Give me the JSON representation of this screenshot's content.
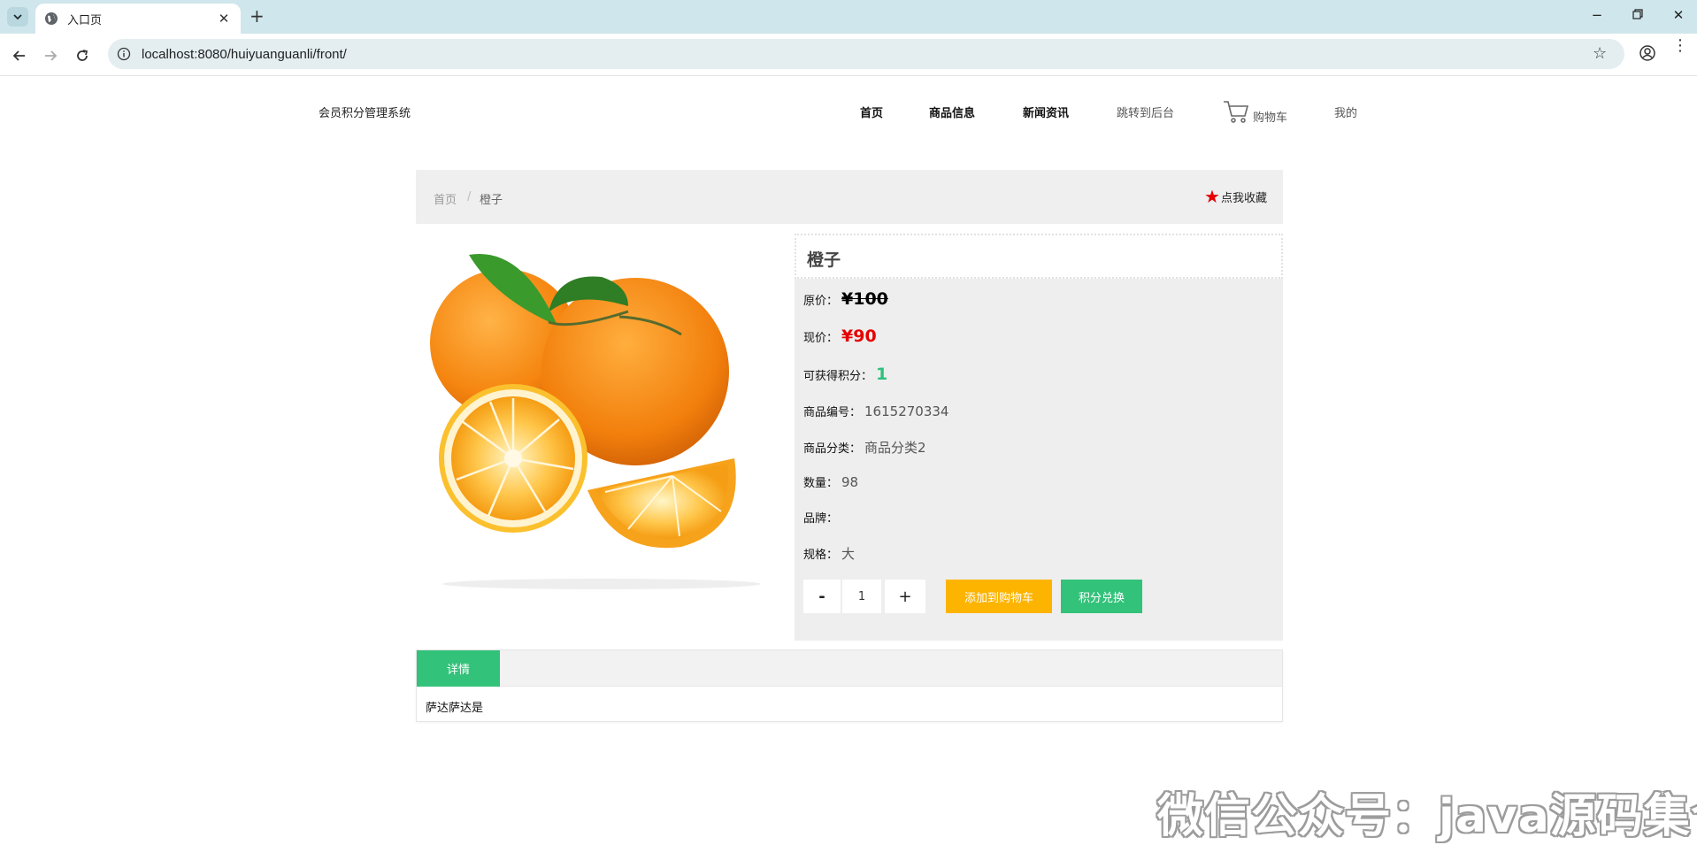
{
  "browser": {
    "tab_title": "入口页",
    "url": "localhost:8080/huiyuanguanli/front/"
  },
  "header": {
    "site_title": "会员积分管理系统",
    "nav": [
      "首页",
      "商品信息",
      "新闻资讯",
      "跳转到后台",
      "购物车",
      "我的"
    ]
  },
  "breadcrumb": {
    "home": "首页",
    "separator": "/",
    "current": "橙子",
    "favorite_label": "点我收藏"
  },
  "product": {
    "name": "橙子",
    "original_price_label": "原价：",
    "original_price": "¥100",
    "current_price_label": "现价：",
    "current_price": "¥90",
    "points_label": "可获得积分：",
    "points": "1",
    "sku_label": "商品编号：",
    "sku": "1615270334",
    "category_label": "商品分类：",
    "category": "商品分类2",
    "quantity_label": "数量：",
    "quantity": "98",
    "brand_label": "品牌：",
    "brand": "",
    "spec_label": "规格：",
    "spec": "大"
  },
  "purchase": {
    "minus": "-",
    "qty": "1",
    "plus": "+",
    "add_to_cart": "添加到购物车",
    "redeem": "积分兑换"
  },
  "details": {
    "tab_label": "详情",
    "content": "萨达萨达是"
  },
  "watermark": "微信公众号：java源码集合",
  "colors": {
    "accent_green": "#33c27a",
    "accent_orange": "#fcb400",
    "price_red": "#e60000"
  }
}
